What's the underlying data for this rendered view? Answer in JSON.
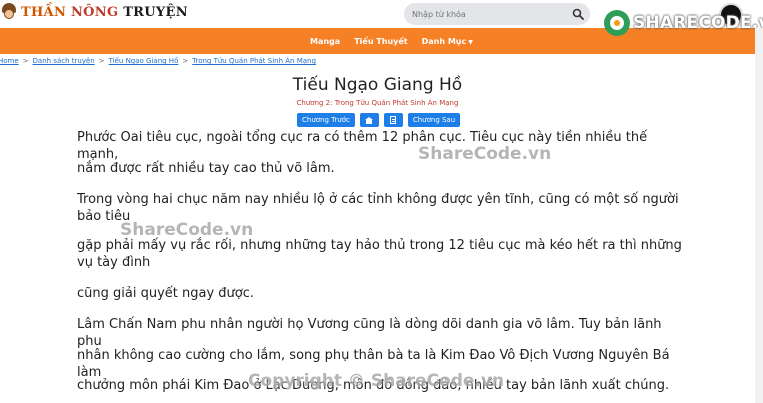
{
  "header": {
    "logo": {
      "word1": "THẦN",
      "word2": "NÔNG",
      "word3": "TRUYỆN"
    },
    "search": {
      "placeholder": "Nhập từ khóa"
    },
    "brand": {
      "text": "SHARECODE",
      "suffix": ".vn"
    }
  },
  "nav": {
    "items": [
      {
        "label": "Manga"
      },
      {
        "label": "Tiểu Thuyết"
      },
      {
        "label": "Danh Mục"
      }
    ]
  },
  "breadcrumb": [
    "Home",
    "Danh sách truyện",
    "Tiếu Ngạo Giang Hồ",
    "Trong Tửu Quán Phát Sinh Án Mạng"
  ],
  "story": {
    "title": "Tiếu Ngạo Giang Hồ",
    "chapter": "Chương 2: Trong Tửu Quán Phát Sinh Án Mạng"
  },
  "controls": {
    "prev_label": "Chương Trước",
    "next_label": "Chương Sau",
    "home_icon": "home-icon",
    "list_icon": "list-icon"
  },
  "paragraphs": [
    "Phước Oai tiêu cục, ngoài tổng cục ra có thêm 12 phân cục. Tiêu cục này tiền nhiều thế mạnh,",
    "nắm được rất nhiều tay cao thủ võ lâm.",
    "Trong vòng hai chục năm nay nhiều lộ ở các tỉnh không được yên tĩnh, cũng có một số người bảo tiêu",
    "gặp phải mấy vụ rắc rối, nhưng những tay hảo thủ trong 12 tiêu cục mà kéo hết ra thì những vụ tày đình",
    "cũng giải quyết ngay được.",
    "Lâm Chấn Nam phu nhân người họ Vương cũng là dòng dõi danh gia võ lâm. Tuy bản lãnh phu",
    "nhân không cao cường cho lắm, song phụ thân bà ta là Kim Đao Vô Địch Vương Nguyên Bá làm",
    "chưởng môn phái Kim Đao ở Lạc Dương, môn đồ đông đảo, nhiều tay bản lãnh xuất chúng."
  ],
  "watermarks": {
    "top": "ShareCode.vn",
    "middle": "ShareCode.vn",
    "bottom": "Copyright © ShareCode.vn"
  },
  "colors": {
    "nav_bg": "#f58025",
    "button_bg": "#1e7ee8",
    "chapter_text": "#c0392b",
    "link": "#1f6fd1"
  }
}
